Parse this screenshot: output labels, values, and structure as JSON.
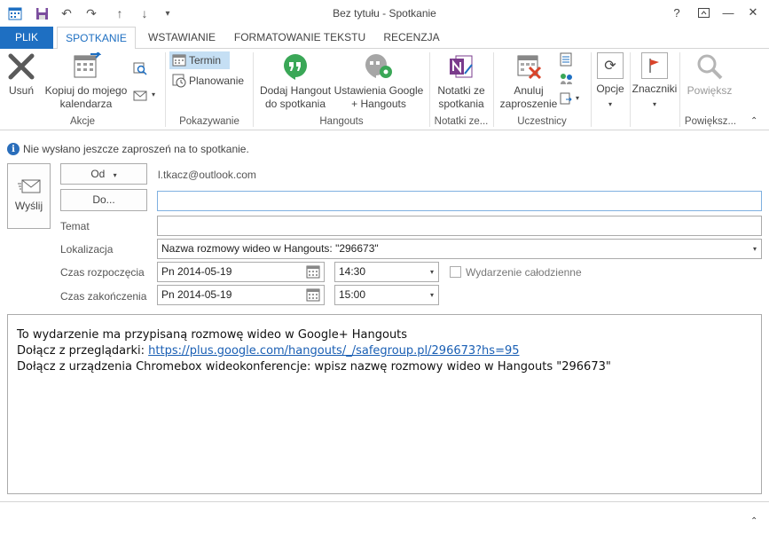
{
  "window": {
    "title": "Bez tytułu - Spotkanie",
    "help": "?",
    "colors": {
      "accent": "#1e6fc2",
      "hangouts_green": "#3aa757",
      "onenote_purple": "#7a3b8c",
      "flag_red": "#d9442a"
    }
  },
  "tabs": [
    {
      "label": "PLIK"
    },
    {
      "label": "SPOTKANIE"
    },
    {
      "label": "WSTAWIANIE"
    },
    {
      "label": "FORMATOWANIE TEKSTU"
    },
    {
      "label": "RECENZJA"
    }
  ],
  "ribbon": {
    "actions": {
      "delete": "Usuń",
      "copy_line1": "Kopiuj do mojego",
      "copy_line2": "kalendarza",
      "group": "Akcje"
    },
    "show": {
      "appointment": "Termin",
      "scheduling": "Planowanie",
      "group": "Pokazywanie"
    },
    "hangouts": {
      "add_line1": "Dodaj Hangout",
      "add_line2": "do spotkania",
      "settings_line1": "Ustawienia Google",
      "settings_line2": "+ Hangouts",
      "group": "Hangouts"
    },
    "notes": {
      "line1": "Notatki ze",
      "line2": "spotkania",
      "group": "Notatki ze..."
    },
    "attendees": {
      "cancel_line1": "Anuluj",
      "cancel_line2": "zaproszenie",
      "group": "Uczestnicy"
    },
    "options": {
      "label": "Opcje"
    },
    "tags": {
      "label": "Znaczniki"
    },
    "zoom": {
      "label": "Powiększ",
      "group": "Powiększ..."
    }
  },
  "info": {
    "text": "Nie wysłano jeszcze zaproszeń na to spotkanie."
  },
  "form": {
    "send": "Wyślij",
    "from_btn": "Od",
    "from_value": "l.tkacz@outlook.com",
    "to_btn": "Do...",
    "to_value": "",
    "subject_label": "Temat",
    "subject_value": "",
    "location_label": "Lokalizacja",
    "location_value": "Nazwa rozmowy wideo w Hangouts: \"296673\"",
    "start_label": "Czas rozpoczęcia",
    "start_date": "Pn 2014-05-19",
    "start_time": "14:30",
    "allday_label": "Wydarzenie całodzienne",
    "end_label": "Czas zakończenia",
    "end_date": "Pn 2014-05-19",
    "end_time": "15:00"
  },
  "body": {
    "line1": "To wydarzenie ma przypisaną rozmowę wideo w Google+ Hangouts",
    "line2_prefix": "Dołącz z przeglądarki: ",
    "line2_link": "https://plus.google.com/hangouts/_/safegroup.pl/296673?hs=95",
    "line3": "Dołącz z urządzenia Chromebox wideokonferencje: wpisz nazwę rozmowy wideo w Hangouts \"296673\""
  }
}
